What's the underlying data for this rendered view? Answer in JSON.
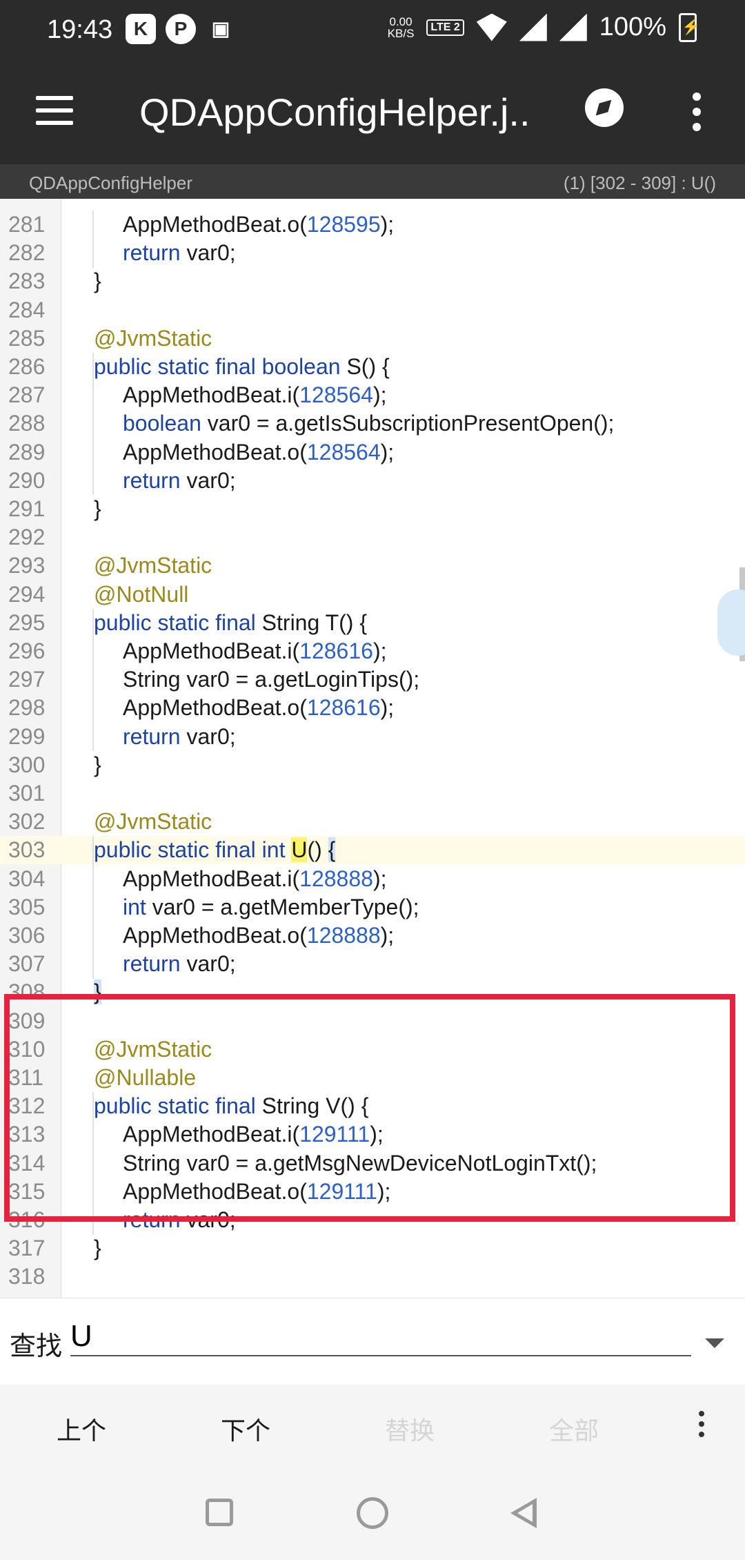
{
  "status_bar": {
    "time": "19:43",
    "net_speed_value": "0.00",
    "net_speed_unit": "KB/S",
    "volte": "LTE 2",
    "signal1": "4G",
    "signal2": "4G",
    "battery": "100%",
    "app_icons": [
      "K",
      "P",
      "▣"
    ]
  },
  "toolbar": {
    "title": "QDAppConfigHelper.j..."
  },
  "path_bar": {
    "file": "QDAppConfigHelper",
    "position": "(1)  [302 - 309] : U()"
  },
  "code_lines": [
    {
      "n": "281",
      "indent": 2,
      "parts": [
        [
          "AppMethodBeat.o(",
          ""
        ],
        [
          "128595",
          "num"
        ],
        [
          ");",
          ""
        ]
      ]
    },
    {
      "n": "282",
      "indent": 2,
      "parts": [
        [
          "return",
          "kw"
        ],
        [
          " var0;",
          ""
        ]
      ]
    },
    {
      "n": "283",
      "indent": 1,
      "parts": [
        [
          "}",
          ""
        ]
      ]
    },
    {
      "n": "284",
      "indent": 1,
      "parts": []
    },
    {
      "n": "285",
      "indent": 1,
      "parts": [
        [
          "@JvmStatic",
          "ann"
        ]
      ]
    },
    {
      "n": "286",
      "indent": 1,
      "parts": [
        [
          "public static final boolean",
          "kw"
        ],
        [
          " S() {",
          ""
        ]
      ]
    },
    {
      "n": "287",
      "indent": 2,
      "parts": [
        [
          "AppMethodBeat.i(",
          ""
        ],
        [
          "128564",
          "num"
        ],
        [
          ");",
          ""
        ]
      ]
    },
    {
      "n": "288",
      "indent": 2,
      "parts": [
        [
          "boolean",
          "kw"
        ],
        [
          " var0 = a.getIsSubscriptionPresentOpen();",
          ""
        ]
      ]
    },
    {
      "n": "289",
      "indent": 2,
      "parts": [
        [
          "AppMethodBeat.o(",
          ""
        ],
        [
          "128564",
          "num"
        ],
        [
          ");",
          ""
        ]
      ]
    },
    {
      "n": "290",
      "indent": 2,
      "parts": [
        [
          "return",
          "kw"
        ],
        [
          " var0;",
          ""
        ]
      ]
    },
    {
      "n": "291",
      "indent": 1,
      "parts": [
        [
          "}",
          ""
        ]
      ]
    },
    {
      "n": "292",
      "indent": 1,
      "parts": []
    },
    {
      "n": "293",
      "indent": 1,
      "parts": [
        [
          "@JvmStatic",
          "ann"
        ]
      ]
    },
    {
      "n": "294",
      "indent": 1,
      "parts": [
        [
          "@NotNull",
          "ann"
        ]
      ]
    },
    {
      "n": "295",
      "indent": 1,
      "parts": [
        [
          "public static final",
          "kw"
        ],
        [
          " String T() {",
          ""
        ]
      ]
    },
    {
      "n": "296",
      "indent": 2,
      "parts": [
        [
          "AppMethodBeat.i(",
          ""
        ],
        [
          "128616",
          "num"
        ],
        [
          ");",
          ""
        ]
      ]
    },
    {
      "n": "297",
      "indent": 2,
      "parts": [
        [
          "String var0 = a.getLoginTips();",
          ""
        ]
      ]
    },
    {
      "n": "298",
      "indent": 2,
      "parts": [
        [
          "AppMethodBeat.o(",
          ""
        ],
        [
          "128616",
          "num"
        ],
        [
          ");",
          ""
        ]
      ]
    },
    {
      "n": "299",
      "indent": 2,
      "parts": [
        [
          "return",
          "kw"
        ],
        [
          " var0;",
          ""
        ]
      ]
    },
    {
      "n": "300",
      "indent": 1,
      "parts": [
        [
          "}",
          ""
        ]
      ]
    },
    {
      "n": "301",
      "indent": 1,
      "parts": []
    },
    {
      "n": "302",
      "indent": 1,
      "parts": [
        [
          "@JvmStatic",
          "ann"
        ]
      ]
    },
    {
      "n": "303",
      "indent": 1,
      "parts": [
        [
          "public static final int",
          "kw"
        ],
        [
          " ",
          ""
        ],
        [
          "U",
          "match"
        ],
        [
          "() ",
          ""
        ],
        [
          "{",
          "brace-hl"
        ]
      ],
      "highlight": true
    },
    {
      "n": "304",
      "indent": 2,
      "parts": [
        [
          "AppMethodBeat.i(",
          ""
        ],
        [
          "128888",
          "num"
        ],
        [
          ");",
          ""
        ]
      ]
    },
    {
      "n": "305",
      "indent": 2,
      "parts": [
        [
          "int",
          "kw"
        ],
        [
          " var0 = a.getMemberType();",
          ""
        ]
      ]
    },
    {
      "n": "306",
      "indent": 2,
      "parts": [
        [
          "AppMethodBeat.o(",
          ""
        ],
        [
          "128888",
          "num"
        ],
        [
          ");",
          ""
        ]
      ]
    },
    {
      "n": "307",
      "indent": 2,
      "parts": [
        [
          "return",
          "kw"
        ],
        [
          " var0;",
          ""
        ]
      ]
    },
    {
      "n": "308",
      "indent": 1,
      "parts": [
        [
          "}",
          "brace-hl"
        ]
      ]
    },
    {
      "n": "309",
      "indent": 1,
      "parts": []
    },
    {
      "n": "310",
      "indent": 1,
      "parts": [
        [
          "@JvmStatic",
          "ann"
        ]
      ]
    },
    {
      "n": "311",
      "indent": 1,
      "parts": [
        [
          "@Nullable",
          "ann"
        ]
      ]
    },
    {
      "n": "312",
      "indent": 1,
      "parts": [
        [
          "public static final",
          "kw"
        ],
        [
          " String V() {",
          ""
        ]
      ]
    },
    {
      "n": "313",
      "indent": 2,
      "parts": [
        [
          "AppMethodBeat.i(",
          ""
        ],
        [
          "129111",
          "num"
        ],
        [
          ");",
          ""
        ]
      ]
    },
    {
      "n": "314",
      "indent": 2,
      "parts": [
        [
          "String var0 = a.getMsgNewDeviceNotLoginTxt();",
          ""
        ]
      ]
    },
    {
      "n": "315",
      "indent": 2,
      "parts": [
        [
          "AppMethodBeat.o(",
          ""
        ],
        [
          "129111",
          "num"
        ],
        [
          ");",
          ""
        ]
      ]
    },
    {
      "n": "316",
      "indent": 2,
      "parts": [
        [
          "return",
          "kw"
        ],
        [
          " var0;",
          ""
        ]
      ]
    },
    {
      "n": "317",
      "indent": 1,
      "parts": [
        [
          "}",
          ""
        ]
      ]
    },
    {
      "n": "318",
      "indent": 1,
      "parts": []
    }
  ],
  "find_bar": {
    "label": "查找",
    "value": "U"
  },
  "actions": {
    "prev": "上个",
    "next": "下个",
    "replace": "替换",
    "all": "全部"
  },
  "colors": {
    "toolbar_bg": "#2b2b2b",
    "keyword": "#1d44a4",
    "number": "#2d5fc8",
    "annotation": "#9a8a1c",
    "red_box": "#e8223c",
    "match_bg": "#fff36b"
  },
  "icons": [
    "menu-icon",
    "compass-icon",
    "more-vert-icon",
    "dropdown-icon",
    "recents-icon",
    "home-icon",
    "back-icon"
  ]
}
